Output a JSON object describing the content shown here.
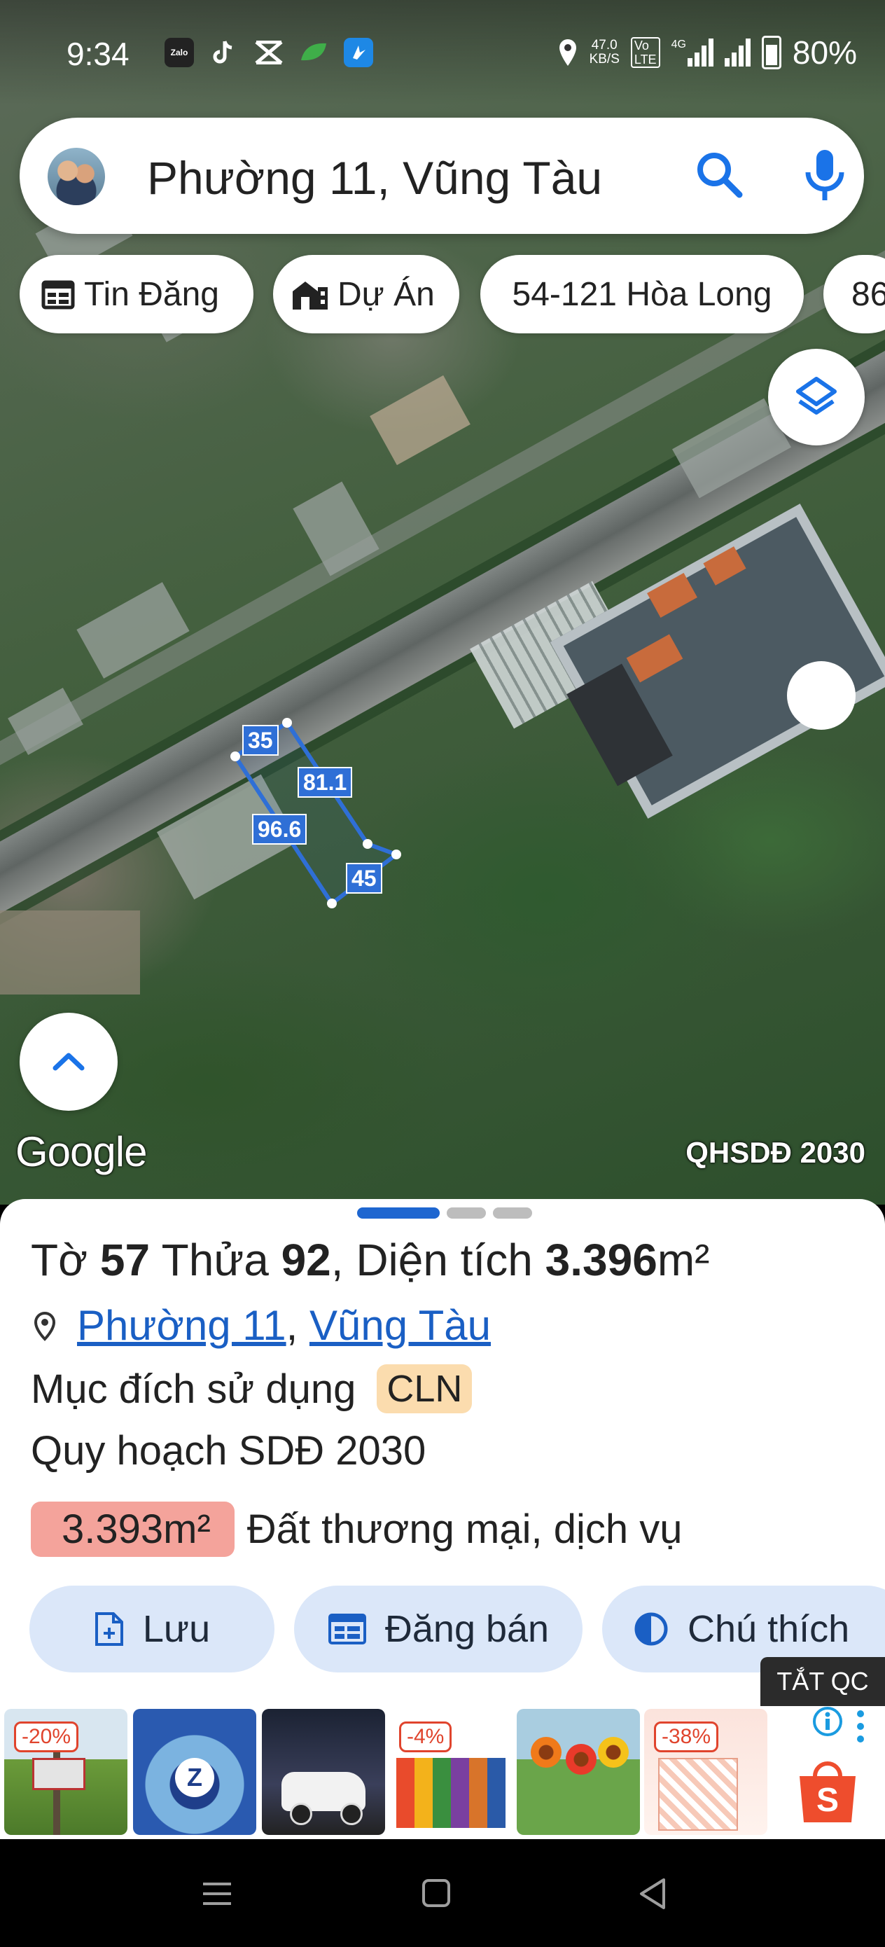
{
  "status_bar": {
    "time": "9:34",
    "net_speed_value": "47.0",
    "net_speed_unit": "KB/S",
    "volte_top": "Vo",
    "volte_bottom": "LTE",
    "network_type": "4G",
    "battery": "80%",
    "app_icons": [
      "zalo-icon",
      "tiktok-icon",
      "app-icon",
      "leaf-icon",
      "messenger-icon"
    ]
  },
  "search": {
    "query": "Phường 11, Vũng Tàu"
  },
  "chips": [
    {
      "label": "Tin Đăng",
      "icon": "calendar-icon"
    },
    {
      "label": "Dự Án",
      "icon": "building-icon"
    },
    {
      "label": "54-121 Hòa Long",
      "icon": ""
    },
    {
      "label": "86",
      "icon": ""
    }
  ],
  "parcel_edges": [
    "35",
    "81.1",
    "96.6",
    "45"
  ],
  "map": {
    "attribution": "Google",
    "layer_name": "QHSDĐ 2030"
  },
  "sheet": {
    "sheet_label": "Tờ",
    "sheet_no": "57",
    "plot_label": "Thửa",
    "plot_no": "92",
    "area_label": "Diện tích",
    "area_value": "3.396",
    "area_unit": "m²",
    "ward": "Phường 11",
    "city": "Vũng Tàu",
    "usage_label": "Mục đích sử dụng",
    "usage_code": "CLN",
    "plan_label": "Quy hoạch SDĐ 2030",
    "plan_area": "3.393m²",
    "plan_use": "Đất thương mại, dịch vụ"
  },
  "actions": [
    {
      "label": "Lưu",
      "icon": "save-icon"
    },
    {
      "label": "Đăng bán",
      "icon": "listing-icon"
    },
    {
      "label": "Chú thích",
      "icon": "legend-icon"
    }
  ],
  "ads": {
    "close_label": "TẮT QC",
    "thumbs": [
      {
        "discount": "-20%"
      },
      {
        "discount": ""
      },
      {
        "discount": ""
      },
      {
        "discount": "-4%"
      },
      {
        "discount": ""
      },
      {
        "discount": "-38%"
      }
    ]
  },
  "colors": {
    "accent": "#1e66d0",
    "parcel": "#2f6fd6",
    "usage_tag": "#fbdcae",
    "plan_tag": "#f4a39b",
    "action_bg": "#dbe7f9"
  }
}
